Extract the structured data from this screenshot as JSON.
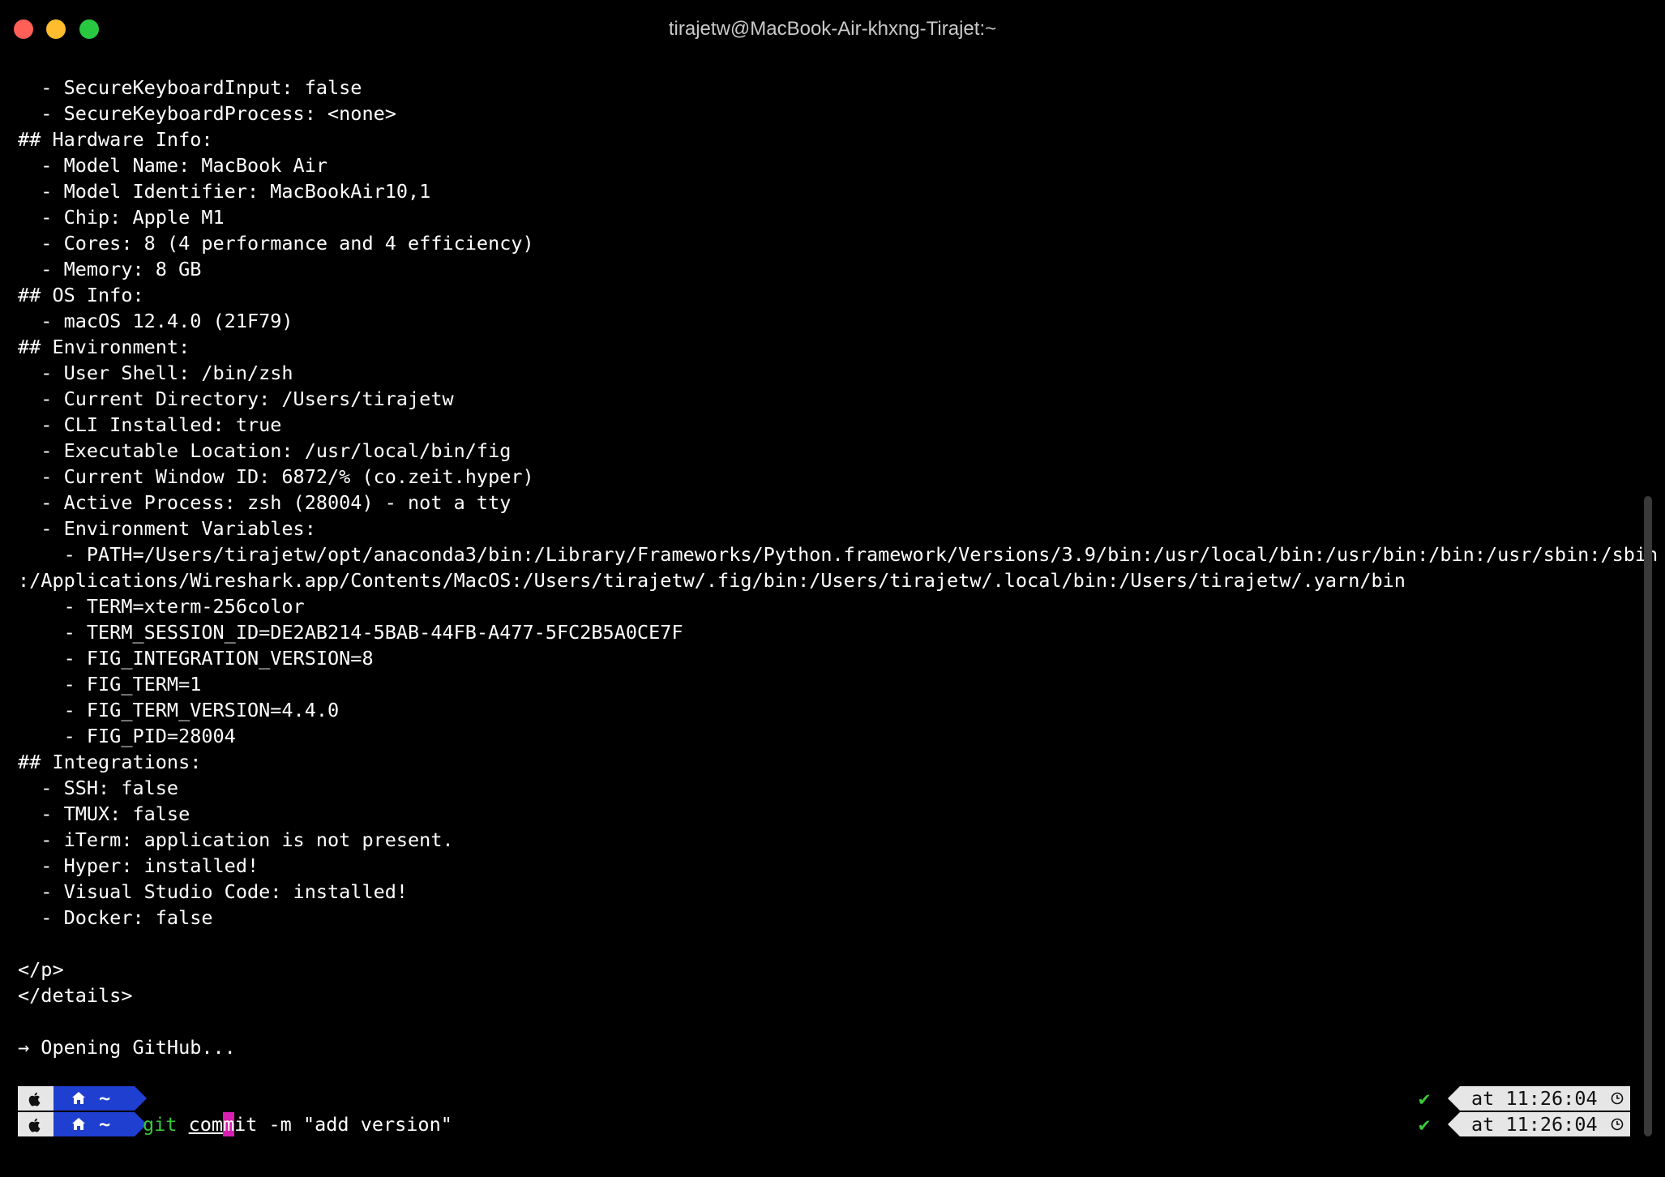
{
  "window": {
    "title": "tirajetw@MacBook-Air-khxng-Tirajet:~"
  },
  "output_lines": [
    "  - SecureKeyboardInput: false",
    "  - SecureKeyboardProcess: <none>",
    "## Hardware Info:",
    "  - Model Name: MacBook Air",
    "  - Model Identifier: MacBookAir10,1",
    "  - Chip: Apple M1",
    "  - Cores: 8 (4 performance and 4 efficiency)",
    "  - Memory: 8 GB",
    "## OS Info:",
    "  - macOS 12.4.0 (21F79)",
    "## Environment:",
    "  - User Shell: /bin/zsh",
    "  - Current Directory: /Users/tirajetw",
    "  - CLI Installed: true",
    "  - Executable Location: /usr/local/bin/fig",
    "  - Current Window ID: 6872/% (co.zeit.hyper)",
    "  - Active Process: zsh (28004) - not a tty",
    "  - Environment Variables:",
    "    - PATH=/Users/tirajetw/opt/anaconda3/bin:/Library/Frameworks/Python.framework/Versions/3.9/bin:/usr/local/bin:/usr/bin:/bin:/usr/sbin:/sbin",
    ":/Applications/Wireshark.app/Contents/MacOS:/Users/tirajetw/.fig/bin:/Users/tirajetw/.local/bin:/Users/tirajetw/.yarn/bin",
    "    - TERM=xterm-256color",
    "    - TERM_SESSION_ID=DE2AB214-5BAB-44FB-A477-5FC2B5A0CE7F",
    "    - FIG_INTEGRATION_VERSION=8",
    "    - FIG_TERM=1",
    "    - FIG_TERM_VERSION=4.4.0",
    "    - FIG_PID=28004",
    "## Integrations:",
    "  - SSH: false",
    "  - TMUX: false",
    "  - iTerm: application is not present.",
    "  - Hyper: installed!",
    "  - Visual Studio Code: installed!",
    "  - Docker: false",
    "",
    "</p>",
    "</details>",
    "",
    "→ Opening GitHub..."
  ],
  "prompt": {
    "dir": "~",
    "command_git": "git",
    "command_word_before_cursor": "com",
    "cursor_char": "m",
    "command_rest": "it -m \"add version\"",
    "status_check": "✔",
    "time": "at 11:26:04"
  },
  "colors": {
    "background": "#000000",
    "text": "#ffffff",
    "home_segment": "#1f3fd0",
    "apple_segment": "#e6e6e6",
    "git_green": "#39c83a",
    "cursor": "#d81fb0"
  },
  "icons": {
    "apple": "apple-logo-icon",
    "home": "home-icon",
    "clock": "clock-icon",
    "check": "checkmark-icon"
  }
}
